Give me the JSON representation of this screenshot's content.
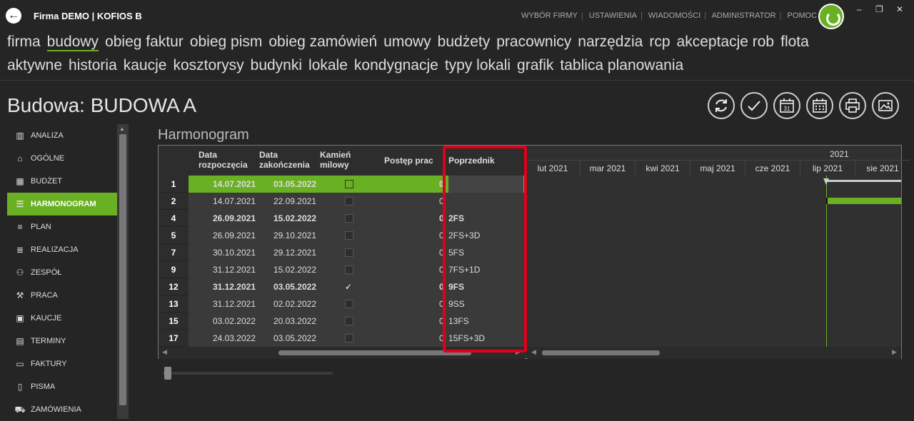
{
  "app": {
    "title": "Firma DEMO | KOFIOS B",
    "back_icon": "arrow-left-icon"
  },
  "top_links": [
    "WYBÓR FIRMY",
    "USTAWIENIA",
    "WIADOMOŚCI",
    "ADMINISTRATOR",
    "POMOC"
  ],
  "window_controls": [
    "–",
    "❐",
    "✕"
  ],
  "nav1": [
    "firma",
    "budowy",
    "obieg faktur",
    "obieg pism",
    "obieg zamówień",
    "umowy",
    "budżety",
    "pracownicy",
    "narzędzia",
    "rcp",
    "akceptacje rob",
    "flota"
  ],
  "nav1_active": "budowy",
  "nav2": [
    "aktywne",
    "historia",
    "kaucje",
    "kosztorysy",
    "budynki",
    "lokale",
    "kondygnacje",
    "typy lokali",
    "grafik",
    "tablica planowania"
  ],
  "page_title": "Budowa: BUDOWA A",
  "toolbar": {
    "calendar_day": "31"
  },
  "sidebar": [
    {
      "label": "ANALIZA",
      "icon": "bar-chart-icon",
      "active": false
    },
    {
      "label": "OGÓLNE",
      "icon": "home-icon",
      "active": false
    },
    {
      "label": "BUDŻET",
      "icon": "calculator-icon",
      "active": false
    },
    {
      "label": "HARMONOGRAM",
      "icon": "gantt-icon",
      "active": true
    },
    {
      "label": "PLAN",
      "icon": "plan-icon",
      "active": false
    },
    {
      "label": "REALIZACJA",
      "icon": "realization-icon",
      "active": false
    },
    {
      "label": "ZESPÓŁ",
      "icon": "team-icon",
      "active": false
    },
    {
      "label": "PRACA",
      "icon": "tools-icon",
      "active": false
    },
    {
      "label": "KAUCJE",
      "icon": "money-icon",
      "active": false
    },
    {
      "label": "TERMINY",
      "icon": "calendar-icon",
      "active": false
    },
    {
      "label": "FAKTURY",
      "icon": "invoice-icon",
      "active": false
    },
    {
      "label": "PISMA",
      "icon": "document-icon",
      "active": false
    },
    {
      "label": "ZAMÓWIENIA",
      "icon": "cart-icon",
      "active": false
    }
  ],
  "section_title": "Harmonogram",
  "table": {
    "headers": {
      "start": [
        "Data",
        "rozpoczęcia"
      ],
      "end": [
        "Data",
        "zakończenia"
      ],
      "milestone": [
        "Kamień",
        "milowy"
      ],
      "progress": "Postęp prac",
      "predecessor": "Poprzednik"
    },
    "rows": [
      {
        "id": "1",
        "start": "14.07.2021",
        "end": "03.05.2022",
        "milestone": false,
        "progress": "0",
        "pred": "",
        "bold": true,
        "selected": true
      },
      {
        "id": "2",
        "start": "14.07.2021",
        "end": "22.09.2021",
        "milestone": false,
        "progress": "0",
        "pred": "",
        "bold": false,
        "selected": false
      },
      {
        "id": "4",
        "start": "26.09.2021",
        "end": "15.02.2022",
        "milestone": false,
        "progress": "0",
        "pred": "2FS",
        "bold": true,
        "selected": false
      },
      {
        "id": "5",
        "start": "26.09.2021",
        "end": "29.10.2021",
        "milestone": false,
        "progress": "0",
        "pred": "2FS+3D",
        "bold": false,
        "selected": false
      },
      {
        "id": "7",
        "start": "30.10.2021",
        "end": "29.12.2021",
        "milestone": false,
        "progress": "0",
        "pred": "5FS",
        "bold": false,
        "selected": false
      },
      {
        "id": "9",
        "start": "31.12.2021",
        "end": "15.02.2022",
        "milestone": false,
        "progress": "0",
        "pred": "7FS+1D",
        "bold": false,
        "selected": false
      },
      {
        "id": "12",
        "start": "31.12.2021",
        "end": "03.05.2022",
        "milestone": true,
        "progress": "0",
        "pred": "9FS",
        "bold": true,
        "selected": false
      },
      {
        "id": "13",
        "start": "31.12.2021",
        "end": "02.02.2022",
        "milestone": false,
        "progress": "0",
        "pred": "9SS",
        "bold": false,
        "selected": false
      },
      {
        "id": "15",
        "start": "03.02.2022",
        "end": "20.03.2022",
        "milestone": false,
        "progress": "0",
        "pred": "13FS",
        "bold": false,
        "selected": false
      },
      {
        "id": "17",
        "start": "24.03.2022",
        "end": "03.05.2022",
        "milestone": false,
        "progress": "0",
        "pred": "15FS+3D",
        "bold": false,
        "selected": false
      }
    ]
  },
  "gantt": {
    "year": "2021",
    "months": [
      "lut 2021",
      "mar 2021",
      "kwi 2021",
      "maj 2021",
      "cze 2021",
      "lip 2021",
      "sie 2021"
    ]
  },
  "colors": {
    "accent": "#6ab023",
    "highlight": "#e0001b"
  }
}
